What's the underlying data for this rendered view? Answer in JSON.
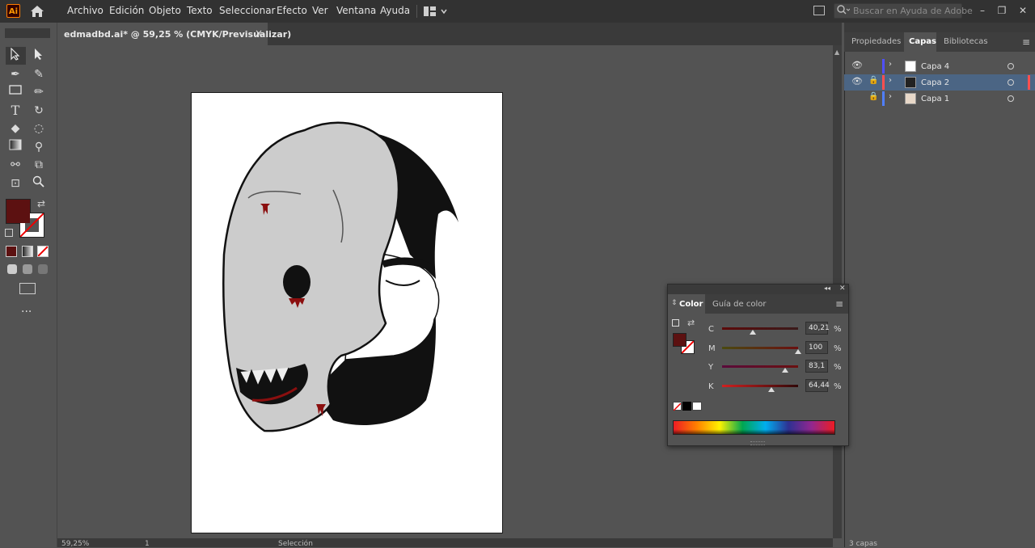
{
  "app": {
    "logo": "Ai"
  },
  "menu": [
    "Archivo",
    "Edición",
    "Objeto",
    "Texto",
    "Seleccionar",
    "Efecto",
    "Ver",
    "Ventana",
    "Ayuda"
  ],
  "search": {
    "placeholder": "Buscar en Ayuda de Adobe"
  },
  "document": {
    "tab_title": "edmadbd.ai* @ 59,25 % (CMYK/Previsualizar)",
    "close": "×"
  },
  "status": {
    "zoom": "59,25%",
    "artboard": "1",
    "tool": "Selección"
  },
  "right_panel": {
    "tabs": [
      "Propiedades",
      "Capas",
      "Bibliotecas"
    ],
    "active_tab": "Capas",
    "layers": [
      {
        "name": "Capa 4",
        "visible": true,
        "locked": false,
        "color": "#4f4fff"
      },
      {
        "name": "Capa 2",
        "visible": true,
        "locked": true,
        "color": "#ff4f4f",
        "selected": true
      },
      {
        "name": "Capa 1",
        "visible": false,
        "locked": true,
        "color": "#4f7fff"
      }
    ],
    "footer": "3 capas"
  },
  "color_panel": {
    "tabs": [
      "Color",
      "Guía de color"
    ],
    "fill_color": "#5c1111",
    "sliders": [
      {
        "label": "C",
        "value": "40,21",
        "fraction": 0.4021
      },
      {
        "label": "M",
        "value": "100",
        "fraction": 1.0
      },
      {
        "label": "Y",
        "value": "83,1",
        "fraction": 0.831
      },
      {
        "label": "K",
        "value": "64,44",
        "fraction": 0.6444
      }
    ],
    "pct": "%"
  },
  "toolbar": {
    "fill_color": "#5c1111"
  },
  "icons": [
    "home-icon",
    "search-icon",
    "selection-tool-icon",
    "direct-selection-icon",
    "pen-icon",
    "curvature-icon",
    "rectangle-icon",
    "pencil-icon",
    "type-icon",
    "rotate-icon",
    "eraser-icon",
    "lasso-icon",
    "gradient-icon",
    "eyedropper-icon",
    "blend-icon",
    "shape-builder-icon",
    "artboard-icon",
    "zoom-icon",
    "eye-icon",
    "lock-icon",
    "chevron-right-icon",
    "menu-icon"
  ]
}
